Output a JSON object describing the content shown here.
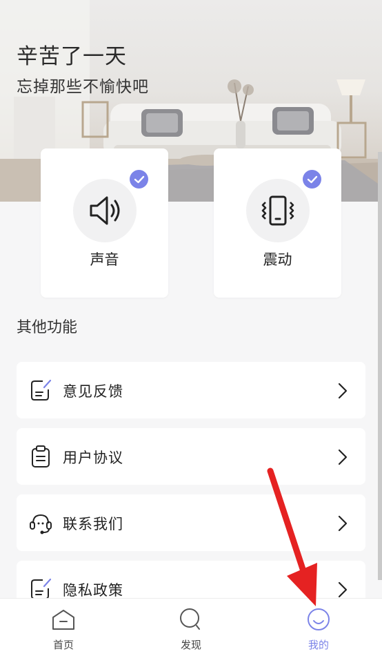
{
  "hero": {
    "title": "辛苦了一天",
    "subtitle": "忘掉那些不愉快吧"
  },
  "modes": [
    {
      "label": "声音",
      "icon": "speaker-icon",
      "checked": true
    },
    {
      "label": "震动",
      "icon": "vibrate-phone-icon",
      "checked": true
    }
  ],
  "other": {
    "title": "其他功能",
    "items": [
      {
        "label": "意见反馈",
        "icon": "feedback-edit-icon"
      },
      {
        "label": "用户协议",
        "icon": "clipboard-icon"
      },
      {
        "label": "联系我们",
        "icon": "headset-icon"
      },
      {
        "label": "隐私政策",
        "icon": "privacy-edit-icon"
      }
    ]
  },
  "tabbar": {
    "tabs": [
      {
        "label": "首页",
        "icon": "home-icon",
        "active": false
      },
      {
        "label": "发现",
        "icon": "search-icon",
        "active": false
      },
      {
        "label": "我的",
        "icon": "smile-icon",
        "active": true
      }
    ]
  },
  "colors": {
    "accent": "#7b83e8",
    "background": "#f6f6f7",
    "annotation": "#e52222"
  }
}
